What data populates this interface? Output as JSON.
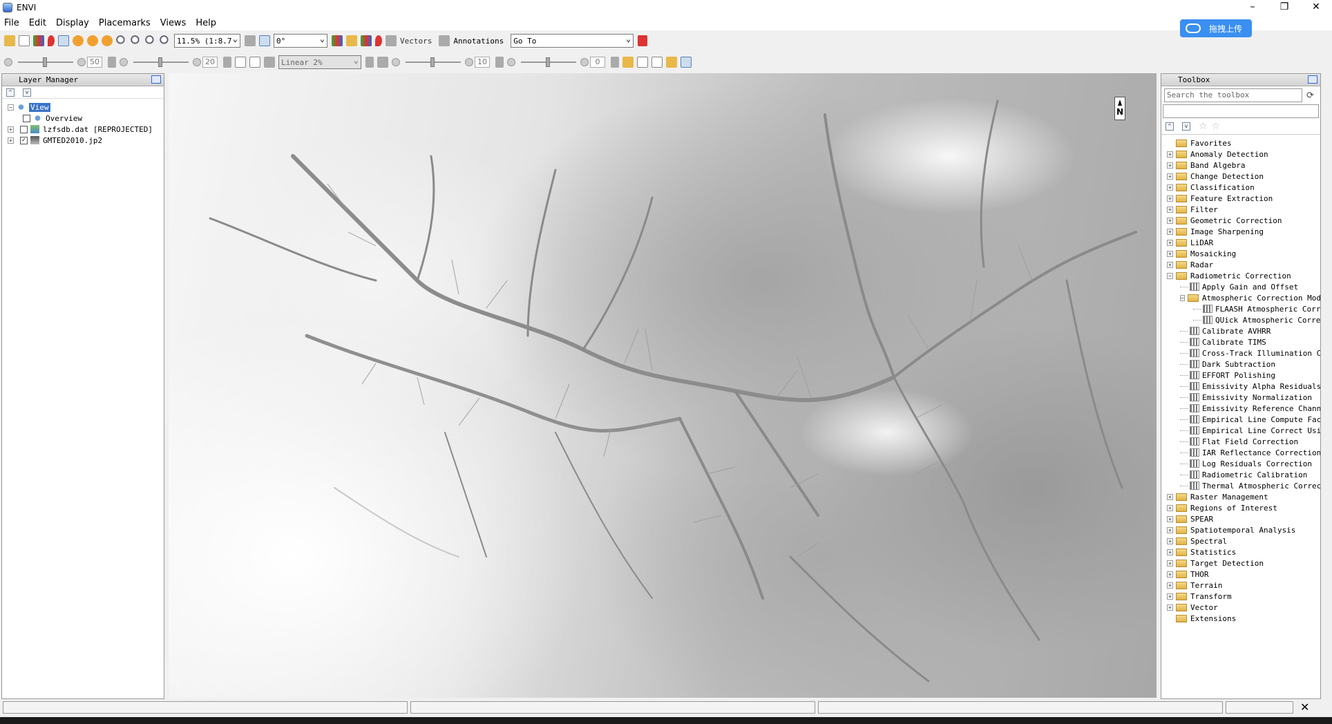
{
  "window": {
    "title": "ENVI",
    "min": "–",
    "max": "❐",
    "close": "✕"
  },
  "menu": [
    "File",
    "Edit",
    "Display",
    "Placemarks",
    "Views",
    "Help"
  ],
  "overlay": {
    "upload_label": "拖拽上传"
  },
  "toolbar": {
    "zoom_value": "11.5% (1:8.7",
    "rotation_value": "0°",
    "vectors_label": "Vectors",
    "annotations_label": "Annotations",
    "goto_value": "Go To"
  },
  "toolbar2": {
    "brightness": "50",
    "contrast": "20",
    "stretch_value": "Linear 2%",
    "sharpen": "10",
    "transparency": "0"
  },
  "layer_manager": {
    "title": "Layer Manager",
    "items": [
      {
        "label": "View"
      },
      {
        "label": "Overview"
      },
      {
        "label": "lzfsdb.dat [REPROJECTED]"
      },
      {
        "label": "GMTED2010.jp2"
      }
    ]
  },
  "toolbox": {
    "title": "Toolbox",
    "search_placeholder": "Search the toolbox",
    "top_folders_a": [
      "Favorites",
      "Anomaly Detection",
      "Band Algebra",
      "Change Detection",
      "Classification",
      "Feature Extraction",
      "Filter",
      "Geometric Correction",
      "Image Sharpening",
      "LiDAR",
      "Mosaicking",
      "Radar"
    ],
    "radiometric": {
      "label": "Radiometric Correction",
      "gain": "Apply Gain and Offset",
      "atmos": "Atmospheric Correction Modul",
      "flaash": "FLAASH Atmospheric Correc",
      "quac": "QUick Atmospheric Correct",
      "tools": [
        "Calibrate AVHRR",
        "Calibrate TIMS",
        "Cross-Track Illumination Cor:",
        "Dark Subtraction",
        "EFFORT Polishing",
        "Emissivity Alpha Residuals",
        "Emissivity Normalization",
        "Emissivity Reference Channel",
        "Empirical Line Compute Facto",
        "Empirical Line Correct Using",
        "Flat Field Correction",
        "IAR Reflectance Correction",
        "Log Residuals Correction",
        "Radiometric Calibration",
        "Thermal Atmospheric Correcti"
      ]
    },
    "top_folders_b": [
      "Raster Management",
      "Regions of Interest",
      "SPEAR",
      "Spatiotemporal Analysis",
      "Spectral",
      "Statistics",
      "Target Detection",
      "THOR",
      "Terrain",
      "Transform",
      "Vector",
      "Extensions"
    ]
  },
  "map": {
    "north_label": "N"
  }
}
